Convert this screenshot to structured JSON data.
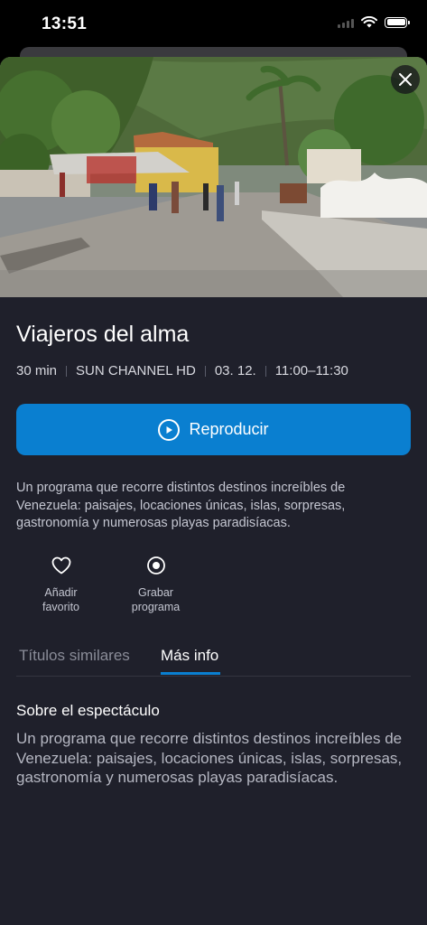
{
  "status": {
    "time": "13:51"
  },
  "hero": {
    "close_icon": "close-icon"
  },
  "program": {
    "title": "Viajeros del alma",
    "meta": [
      "30 min",
      "SUN CHANNEL HD",
      "03. 12.",
      "11:00–11:30"
    ],
    "play_label": "Reproducir",
    "description": "Un programa que recorre distintos destinos increíbles de Venezuela: paisajes, locaciones únicas, islas, sorpresas, gastronomía y numerosas playas paradisíacas."
  },
  "actions": [
    {
      "label": "Añadir favorito",
      "icon": "heart-icon"
    },
    {
      "label": "Grabar programa",
      "icon": "record-icon"
    }
  ],
  "tabs": {
    "similar": "Títulos similares",
    "more_info": "Más info",
    "active": "more_info"
  },
  "more_info": {
    "heading": "Sobre el espectáculo",
    "body": "Un programa que recorre distintos destinos increíbles de Venezuela: paisajes, locaciones únicas, islas, sorpresas, gastronomía y numerosas playas paradisíacas."
  },
  "colors": {
    "accent": "#0a7fd0",
    "background": "#1f202b"
  }
}
